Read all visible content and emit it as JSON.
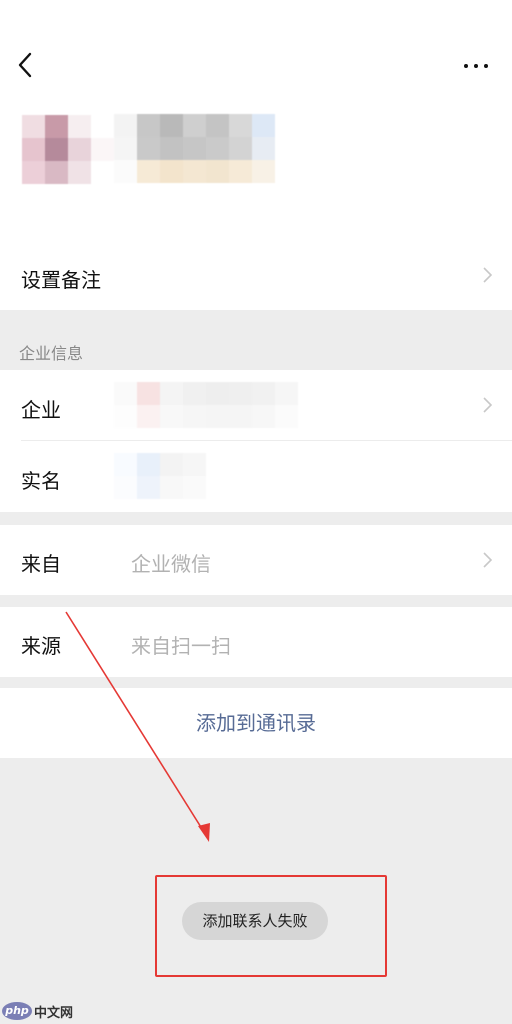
{
  "nav": {
    "back_icon": "chevron-left-icon",
    "more_icon": "more-horizontal-icon"
  },
  "profile": {
    "avatar_icon": "pixelated-avatar",
    "avatar_colors": [
      "#f0dde2",
      "#c89aa8",
      "#f6eef0",
      "#ffffff",
      "#e6c4ce",
      "#b58a9b",
      "#e8d3da",
      "#fbf6f7",
      "#eccfd8",
      "#d9b9c4",
      "#f0e2e6",
      "#ffffff"
    ],
    "name_colors": [
      "#f3f3f3",
      "#c7c7c7",
      "#b9b9b9",
      "#cfcfcf",
      "#c4c4c4",
      "#d8d8d8",
      "#dde8f6",
      "#f5f5f5",
      "#c9c9c9",
      "#c2c2c2",
      "#c6c6c6",
      "#cacaca",
      "#d3d3d3",
      "#e7ecf3",
      "#fbfbfb",
      "#f6ead6",
      "#f3e4cc",
      "#f4e7d2",
      "#f2e5cf",
      "#f6ead7",
      "#f8f1e6"
    ]
  },
  "remark": {
    "label": "设置备注"
  },
  "company_section": {
    "title": "企业信息",
    "enterprise": {
      "label": "企业"
    },
    "realname": {
      "label": "实名"
    }
  },
  "source_from": {
    "label": "来自",
    "value": "企业微信"
  },
  "source": {
    "label": "来源",
    "value": "来自扫一扫"
  },
  "add_button": {
    "label": "添加到通讯录"
  },
  "toast": {
    "message": "添加联系人失败"
  },
  "annotation": {
    "color": "#e53935"
  },
  "watermark": {
    "logo": "php",
    "text": "中文网"
  }
}
